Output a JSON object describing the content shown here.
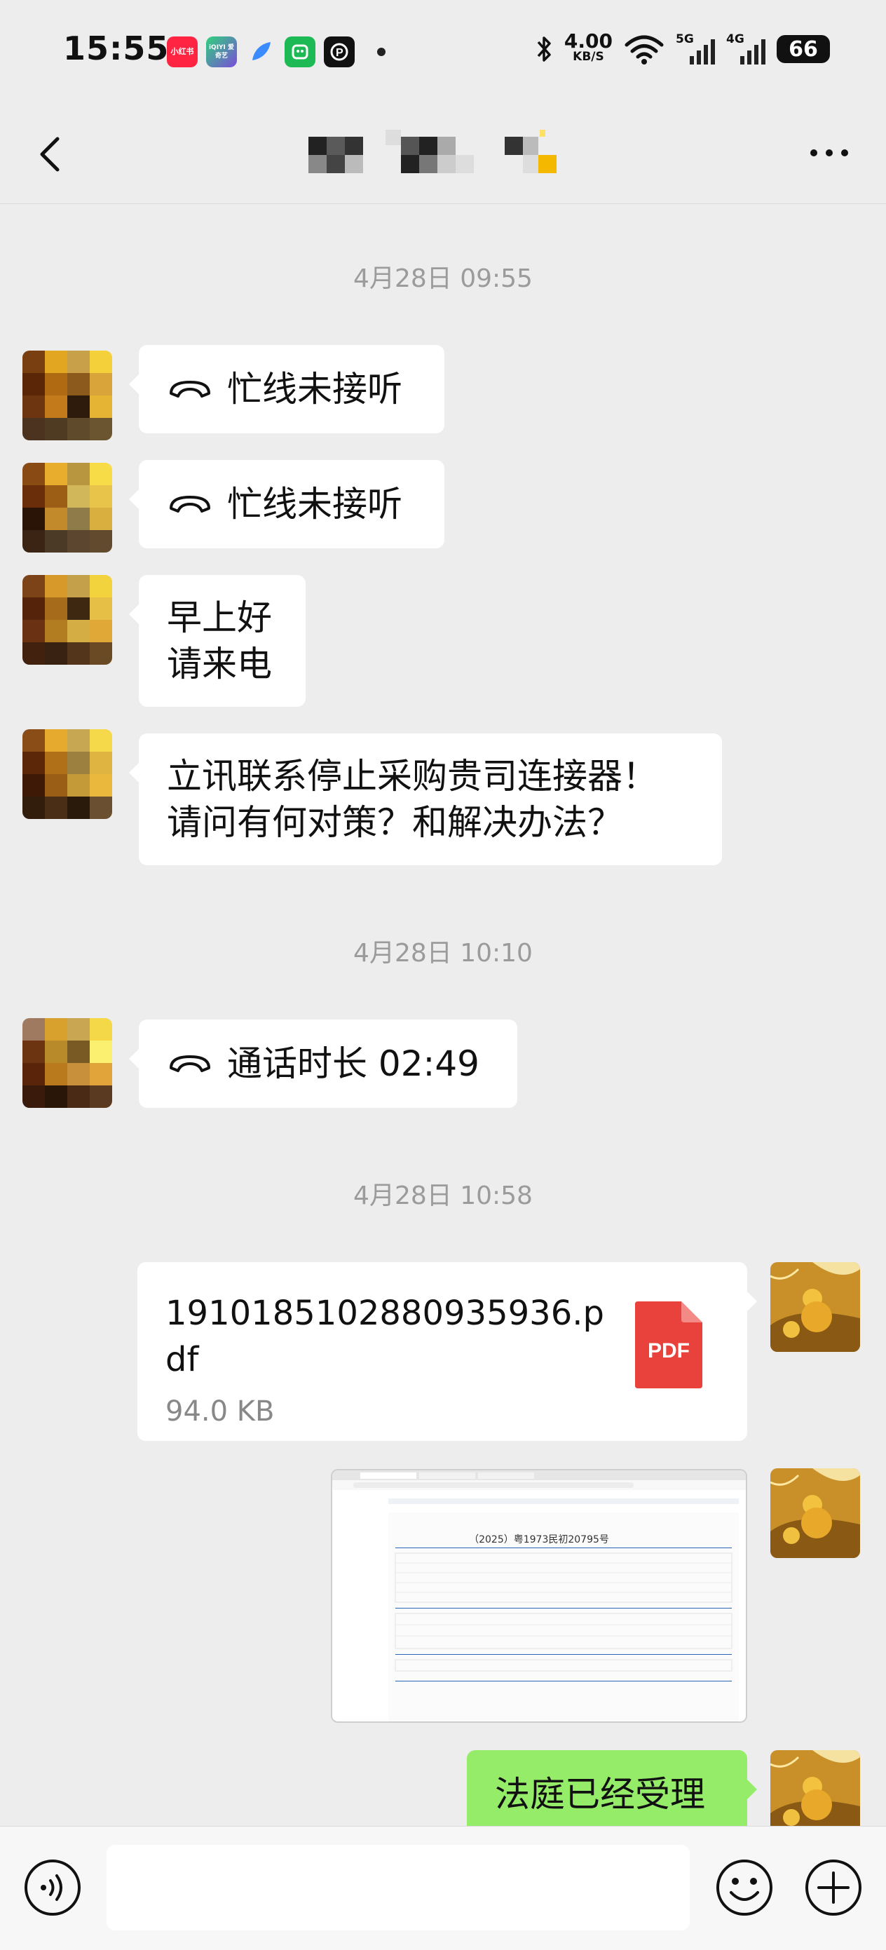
{
  "status_bar": {
    "time": "15:55",
    "net_speed_value": "4.00",
    "net_speed_unit": "KB/S",
    "signal_1": "5G",
    "signal_2": "4G",
    "battery": "66",
    "app_icons": [
      {
        "label": "小红书",
        "color": "#ff2442"
      },
      {
        "label": "iQIYI 爱奇艺",
        "color": "#7a4dd9"
      },
      {
        "label": "",
        "color": "#3a8bff"
      },
      {
        "label": "",
        "color": "#1db954"
      },
      {
        "label": "",
        "color": "#111111"
      }
    ]
  },
  "header": {
    "icons": [
      "back-arrow-icon",
      "more-icon"
    ]
  },
  "messages": {
    "timestamp_1": "4月28日 09:55",
    "call_missed_1": "忙线未接听",
    "call_missed_2": "忙线未接听",
    "greeting_line_1": "早上好",
    "greeting_line_2": "请来电",
    "question_line_1": "立讯联系停止采购贵司连接器！",
    "question_line_2": "请问有何对策？和解决办法？",
    "timestamp_2": "4月28日 10:10",
    "call_duration": "通话时长 02:49",
    "timestamp_3": "4月28日 10:58",
    "file_name": "19101851028809359​36.pdf",
    "file_size": "94.0 KB",
    "file_type_label": "PDF",
    "image_doc_title": "（2025）粤1973民初20795号",
    "reply_text": "法庭已经受理"
  },
  "colors": {
    "background": "#ededed",
    "bubble_white": "#ffffff",
    "bubble_green": "#95ec69",
    "timestamp_gray": "#9b9b9b",
    "pdf_red": "#e9423d"
  },
  "input_bar": {
    "placeholder": "",
    "icons": [
      "voice-icon",
      "emoji-icon",
      "plus-icon"
    ]
  }
}
